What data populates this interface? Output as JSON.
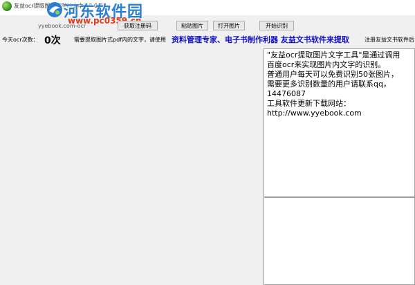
{
  "window": {
    "title": "友益ocr提取图片文字转文本1.0.0.0"
  },
  "watermark": {
    "title": "河东软件园",
    "url": "www.pc0359.cn",
    "sub": "yyebook.com-ocr"
  },
  "toolbar": {
    "register_label": "获取注册码",
    "paste_label": "粘贴图片",
    "open_label": "打开图片",
    "start_label": "开始识别"
  },
  "info": {
    "count_label": "今天ocr次数：",
    "count_value": "0次",
    "hint": "需要提取图片式pdf内的文字，请使用",
    "promo_link": "资料管理专家、电子书制作利器 友益文书软件来提取",
    "register_promo": "注册友益文书软件后"
  },
  "result": {
    "lines": [
      "\"友益ocr提取图片文字工具\"是通过调用",
      "百度ocr来实现图片内文字的识别。",
      "普通用户每天可以免费识别50张图片，",
      "需要更多识别数量的用户请联系qq，",
      "14476087",
      "工具软件更新下载网站：",
      "http://www.yyebook.com"
    ]
  },
  "colors": {
    "promo": "#1010c8",
    "watermark_title": "#2a7fd4",
    "watermark_url": "#e03c1c",
    "panel_border": "#a0a0a0"
  }
}
